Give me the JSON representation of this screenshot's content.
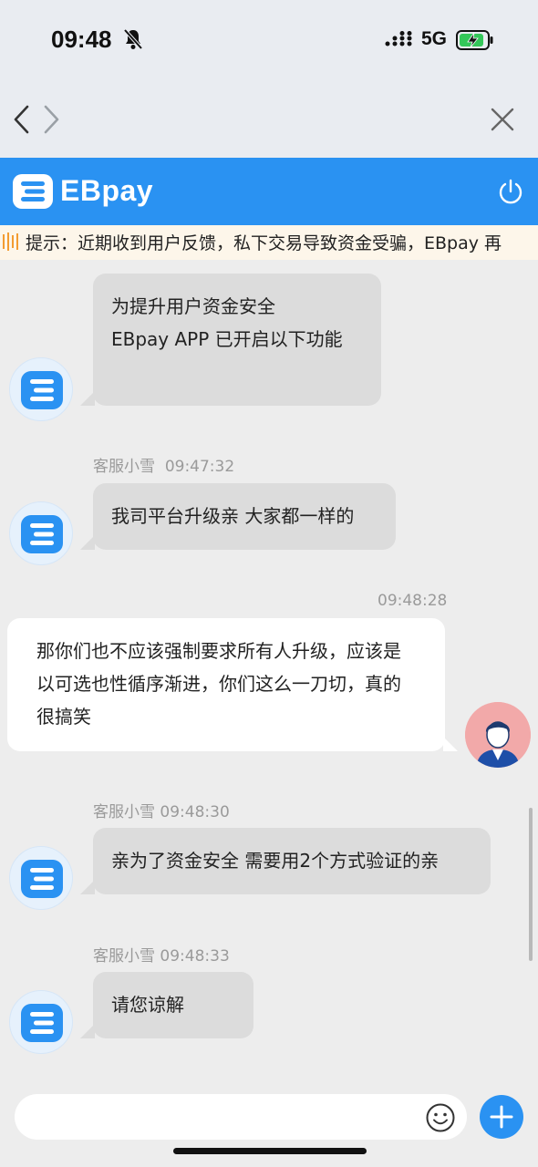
{
  "status_bar": {
    "time": "09:48",
    "network": "5G"
  },
  "nav": {
    "back_icon": "chevron-left-icon",
    "forward_icon": "chevron-right-icon",
    "close_icon": "close-icon"
  },
  "app_header": {
    "brand": "EBpay",
    "power_icon": "power-icon",
    "color": "#2a92f2"
  },
  "notice": {
    "text": "提示：近期收到用户反馈，私下交易导致资金受骗，EBpay 再"
  },
  "messages": [
    {
      "from": "agent",
      "lines": [
        "为提升用户资金安全",
        "EBpay APP 已开启以下功能"
      ]
    },
    {
      "from": "agent",
      "sender": "客服小雪",
      "time": "09:47:32",
      "lines": [
        "我司平台升级亲 大家都一样的"
      ]
    },
    {
      "from": "user",
      "time": "09:48:28",
      "lines": [
        "那你们也不应该强制要求所有人升级，应该是",
        "以可选也性循序渐进，你们这么一刀切，真的",
        "很搞笑"
      ]
    },
    {
      "from": "agent",
      "sender": "客服小雪",
      "time": "09:48:30",
      "lines": [
        "亲为了资金安全 需要用2个方式验证的亲"
      ]
    },
    {
      "from": "agent",
      "sender": "客服小雪",
      "time": "09:48:33",
      "lines": [
        "请您谅解"
      ]
    }
  ],
  "composer": {
    "placeholder": "",
    "emoji_icon": "smiley-icon",
    "add_icon": "plus-icon"
  }
}
